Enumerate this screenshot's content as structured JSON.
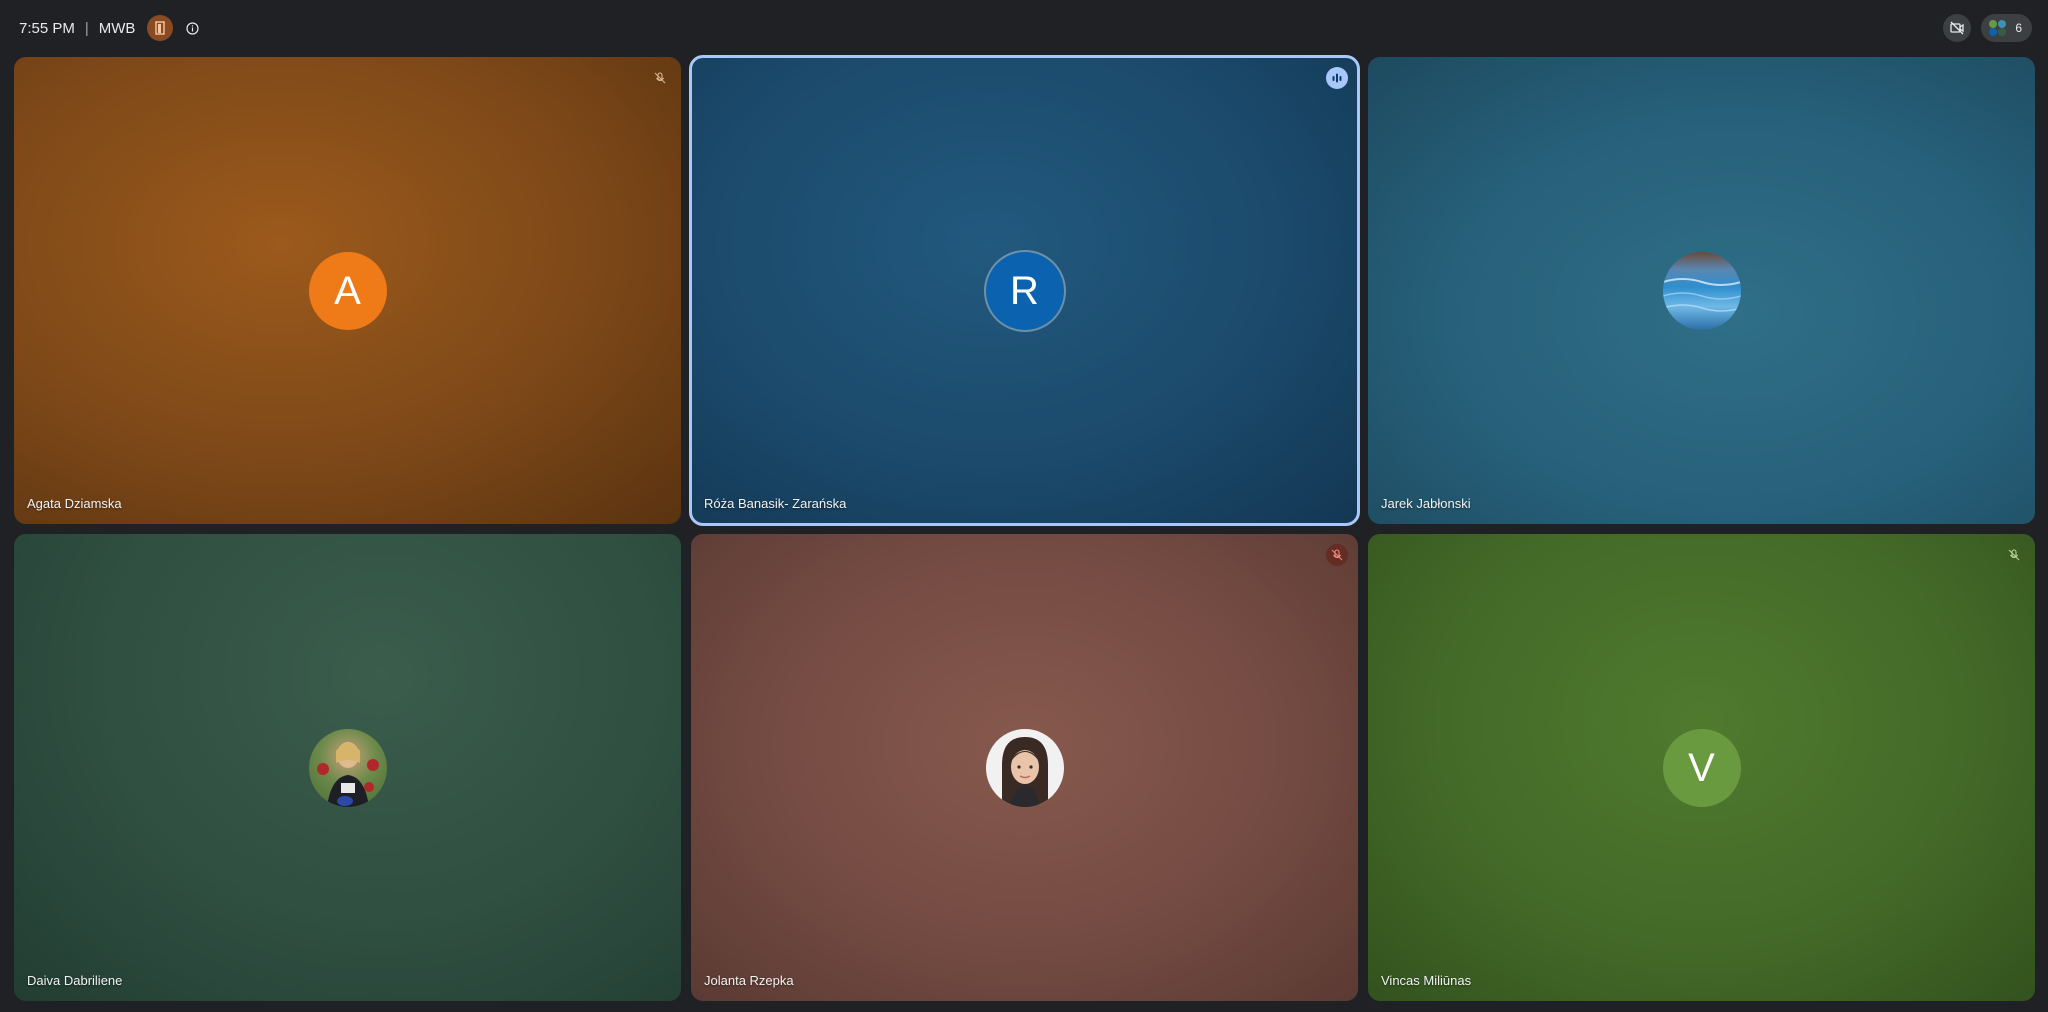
{
  "topbar": {
    "time": "7:55 PM",
    "separator": "|",
    "meeting_code": "MWB",
    "participant_count": "6"
  },
  "tiles": [
    {
      "name": "Agata Dziamska",
      "initial": "A",
      "avatar_color": "#ee7b18",
      "status": "muted"
    },
    {
      "name": "Róża Banasik- Zarańska",
      "initial": "R",
      "avatar_color": "#0b63b0",
      "status": "speaking"
    },
    {
      "name": "Jarek Jabłonski",
      "initial": "",
      "avatar_color": "#3f8fb8",
      "status": "none"
    },
    {
      "name": "Daiva Dabriliene",
      "initial": "",
      "avatar_color": "#3b5b4a",
      "status": "none"
    },
    {
      "name": "Jolanta Rzepka",
      "initial": "",
      "avatar_color": "#e8e8e8",
      "status": "muted"
    },
    {
      "name": "Vincas Miliūnas",
      "initial": "V",
      "avatar_color": "#6a9a3f",
      "status": "muted"
    }
  ],
  "colors": {
    "active_outline": "#a8c7fa",
    "background": "#202124"
  }
}
